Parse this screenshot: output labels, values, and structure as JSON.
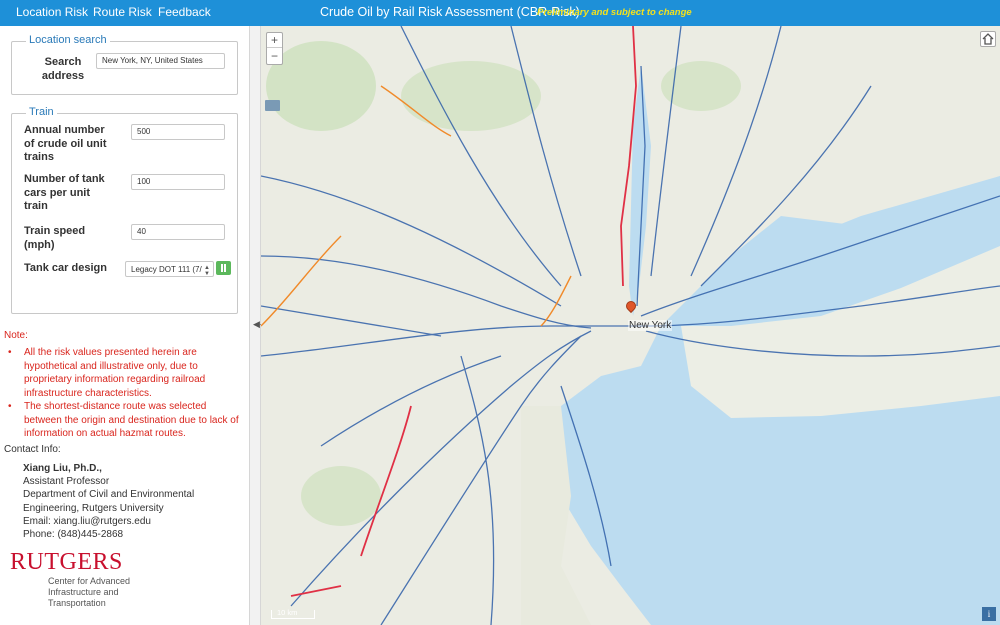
{
  "nav": {
    "location_risk": "Location Risk",
    "route_risk": "Route Risk",
    "feedback": "Feedback"
  },
  "header": {
    "title": "Crude Oil by Rail Risk Assessment (CBR-Risk)",
    "subtitle": "Preliminary and subject to change",
    "bar_color": "#1e90d8",
    "subtitle_color": "#f5e21b"
  },
  "location_search": {
    "legend": "Location search",
    "search_label": "Search address",
    "search_value": "New York, NY, United States"
  },
  "train": {
    "legend": "Train",
    "annual_trains_label": "Annual number of crude oil unit trains",
    "annual_trains_value": "500",
    "tank_cars_label": "Number of tank cars per unit train",
    "tank_cars_value": "100",
    "speed_label": "Train speed (mph)",
    "speed_value": "40",
    "design_label": "Tank car design",
    "design_selected": "Legacy DOT 111 (7/"
  },
  "notes": {
    "title": "Note:",
    "items": [
      "All the risk values presented herein are hypothetical and illustrative only, due to proprietary information regarding railroad infrastructure characteristics.",
      "The shortest-distance route was selected between the origin and destination due to lack of information on actual hazmat routes."
    ],
    "color": "#d9251d"
  },
  "contact": {
    "title": "Contact Info:",
    "name": "Xiang Liu, Ph.D.,",
    "position": "Assistant Professor",
    "department": "Department of Civil and Environmental Engineering, Rutgers University",
    "email": "Email: xiang.liu@rutgers.edu",
    "phone": "Phone: (848)445-2868"
  },
  "logo": {
    "wordmark": "RUTGERS",
    "subtitle": "Center for Advanced Infrastructure and Transportation",
    "color": "#c8102e"
  },
  "map": {
    "zoom_in": "+",
    "zoom_out": "−",
    "city_label": "New York",
    "scale_label": "10 km",
    "info": "i",
    "water_color": "#bcdcf0",
    "land_color": "#ebece3",
    "rail_color": "#2f5fa8",
    "route_color": "#e03045",
    "icons": [
      "zoom-in-icon",
      "zoom-out-icon",
      "layers-icon",
      "home-icon",
      "info-icon",
      "location-pin-icon"
    ]
  }
}
